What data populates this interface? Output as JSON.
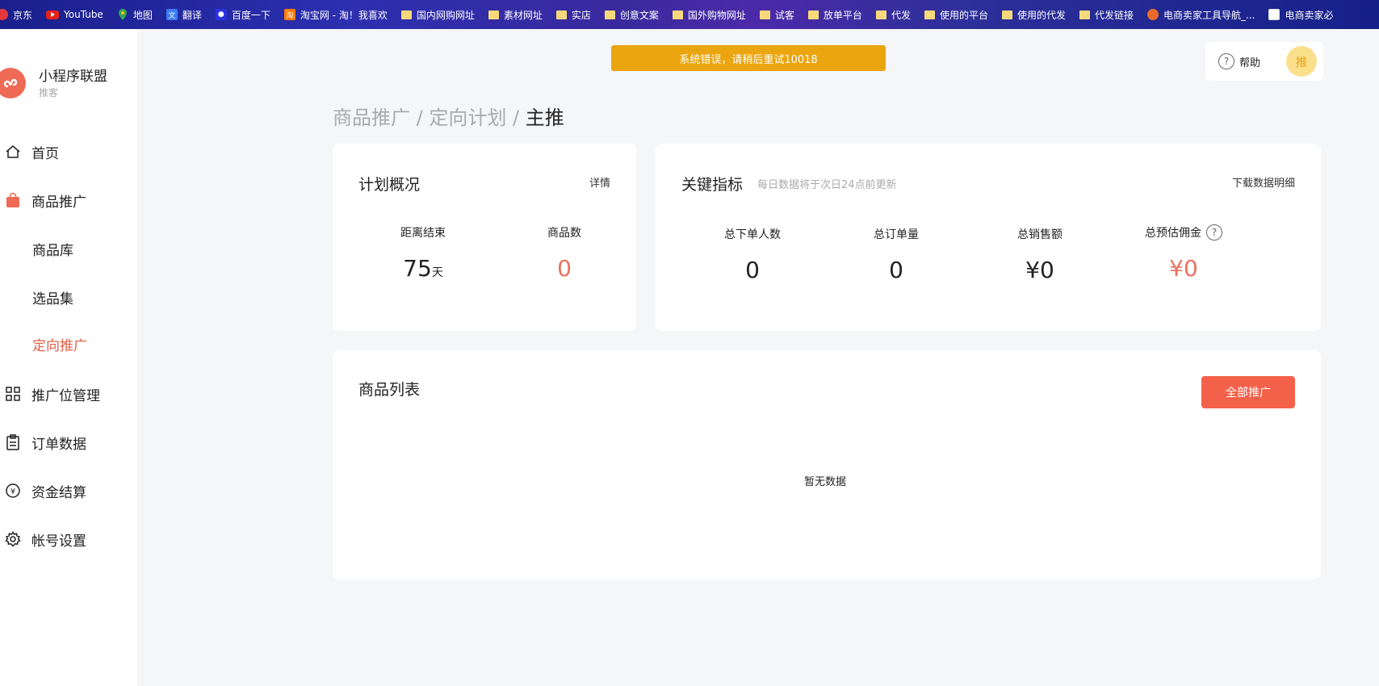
{
  "bookmarks": [
    {
      "label": "京东",
      "icon": "jd-icon"
    },
    {
      "label": "YouTube",
      "icon": "youtube-icon"
    },
    {
      "label": "地图",
      "icon": "map-pin-icon"
    },
    {
      "label": "翻译",
      "icon": "translate-icon"
    },
    {
      "label": "百度一下",
      "icon": "baidu-icon"
    },
    {
      "label": "淘宝网 - 淘！我喜欢",
      "icon": "taobao-icon"
    },
    {
      "label": "国内网购网址",
      "icon": "folder-icon"
    },
    {
      "label": "素材网址",
      "icon": "folder-icon"
    },
    {
      "label": "实店",
      "icon": "folder-icon"
    },
    {
      "label": "创意文案",
      "icon": "folder-icon"
    },
    {
      "label": "国外购物网址",
      "icon": "folder-icon"
    },
    {
      "label": "试客",
      "icon": "folder-icon"
    },
    {
      "label": "放单平台",
      "icon": "folder-icon"
    },
    {
      "label": "代发",
      "icon": "folder-icon"
    },
    {
      "label": "使用的平台",
      "icon": "folder-icon"
    },
    {
      "label": "使用的代发",
      "icon": "folder-icon"
    },
    {
      "label": "代发链接",
      "icon": "folder-icon"
    },
    {
      "label": "电商卖家工具导航_...",
      "icon": "tools-icon"
    },
    {
      "label": "电商卖家必",
      "icon": "shop-icon"
    }
  ],
  "brand": {
    "name": "小程序联盟",
    "sub": "推客"
  },
  "nav": [
    {
      "label": "首页",
      "icon": "home-icon"
    },
    {
      "label": "商品推广",
      "icon": "shopping-bag-icon"
    },
    {
      "label": "商品库",
      "icon": ""
    },
    {
      "label": "选品集",
      "icon": ""
    },
    {
      "label": "定向推广",
      "icon": "",
      "active": true
    },
    {
      "label": "推广位管理",
      "icon": "grid-icon"
    },
    {
      "label": "订单数据",
      "icon": "clipboard-icon"
    },
    {
      "label": "资金结算",
      "icon": "yuan-icon"
    },
    {
      "label": "帐号设置",
      "icon": "gear-icon"
    }
  ],
  "alert": "系统错误，请稍后重试10018",
  "topbar": {
    "help": "帮助",
    "avatar": "推"
  },
  "breadcrumb": {
    "items": [
      "商品推广",
      "定向计划"
    ],
    "sep": "/",
    "current": "主推"
  },
  "plan": {
    "title": "计划概况",
    "detail_link": "详情",
    "metrics": [
      {
        "label": "距离结束",
        "value": "75",
        "unit": "天"
      },
      {
        "label": "商品数",
        "value": "0"
      }
    ]
  },
  "kpi": {
    "title": "关键指标",
    "note": "每日数据将于次日24点前更新",
    "download_link": "下载数据明细",
    "metrics": [
      {
        "label": "总下单人数",
        "value": "0"
      },
      {
        "label": "总订单量",
        "value": "0"
      },
      {
        "label": "总销售额",
        "value": "¥0"
      },
      {
        "label": "总预估佣金",
        "value": "¥0",
        "help": "?"
      }
    ]
  },
  "products": {
    "title": "商品列表",
    "promote_all": "全部推广",
    "empty": "暂无数据"
  },
  "colors": {
    "accent": "#f4614a",
    "alert": "#eaa50f",
    "active_nav": "#e0604a",
    "value_red": "#e8725e"
  }
}
